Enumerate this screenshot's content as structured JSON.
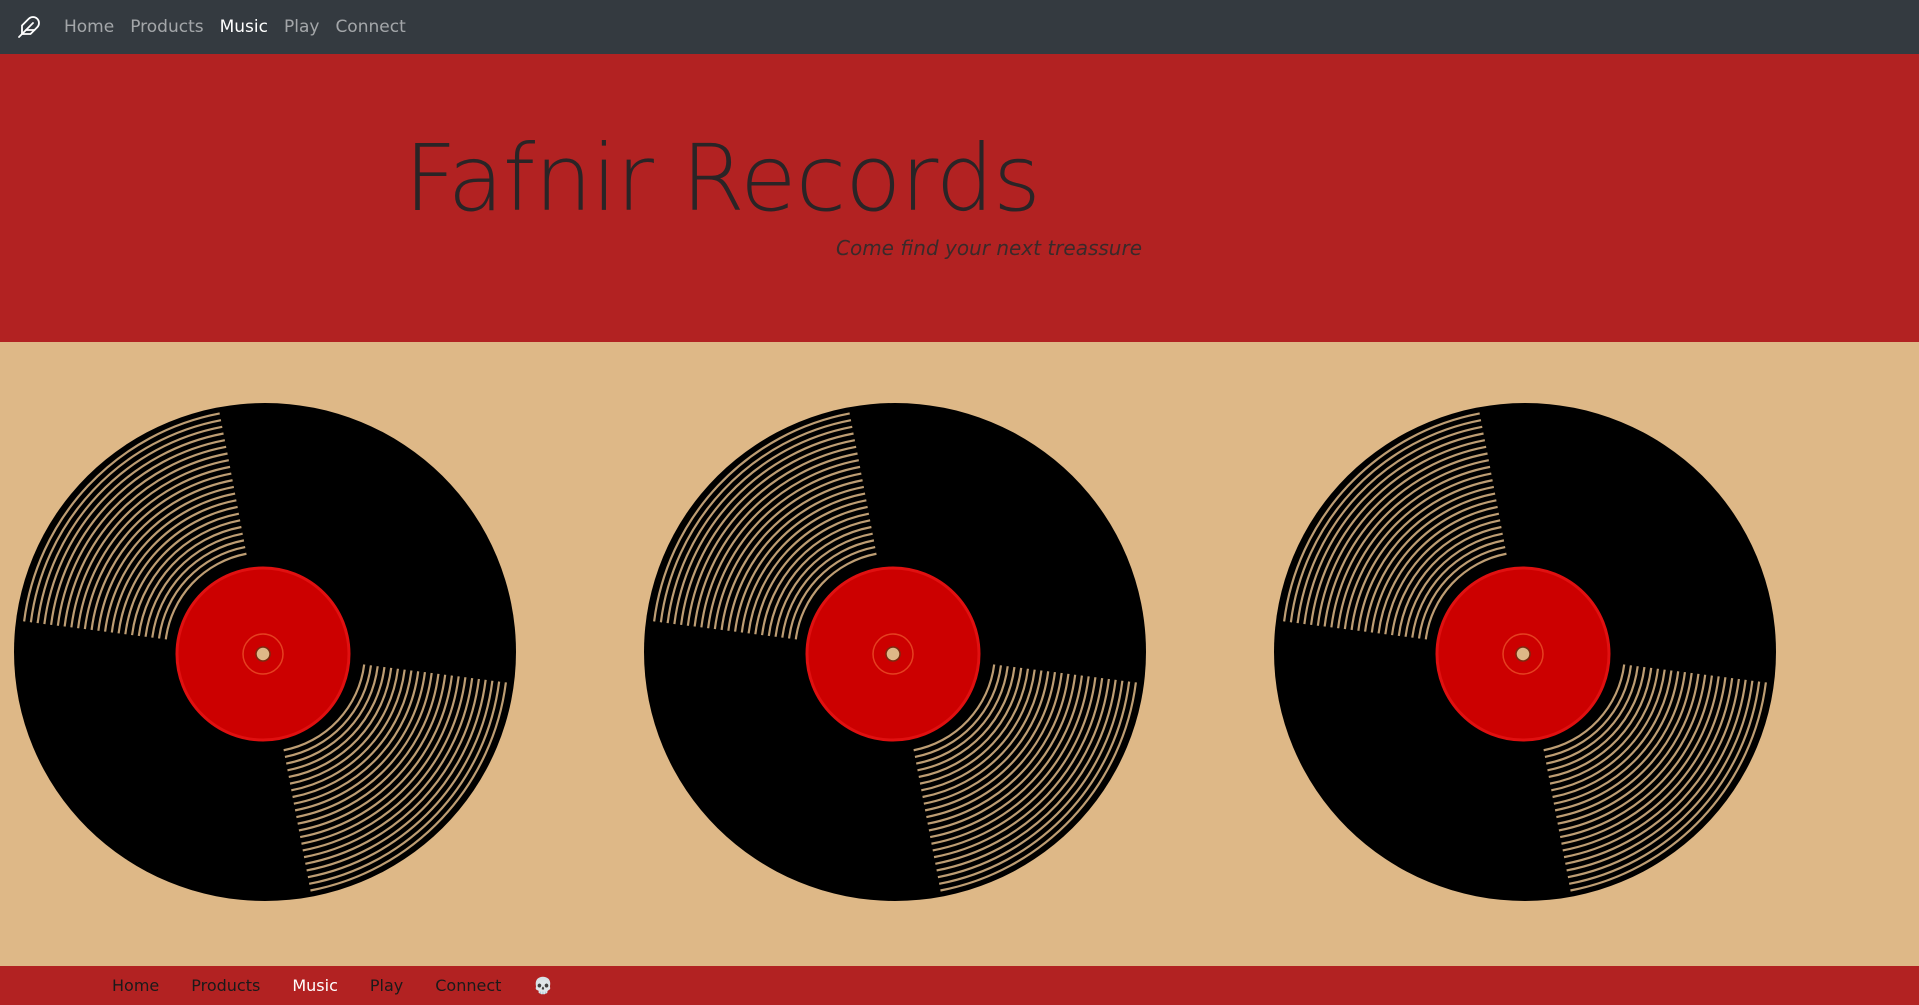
{
  "topnav": {
    "brand_icon": "feather-icon",
    "links": [
      {
        "label": "Home"
      },
      {
        "label": "Products"
      },
      {
        "label": "Music"
      },
      {
        "label": "Play"
      },
      {
        "label": "Connect"
      }
    ],
    "active": "Music"
  },
  "hero": {
    "title": "Fafnir Records",
    "subtitle": "Come find your next treassure"
  },
  "records": {
    "items": [
      {
        "icon": "vinyl-record-icon"
      },
      {
        "icon": "vinyl-record-icon"
      },
      {
        "icon": "vinyl-record-icon"
      }
    ],
    "label_color": "#cc0000"
  },
  "footnav": {
    "links": [
      {
        "label": "Home"
      },
      {
        "label": "Products"
      },
      {
        "label": "Music"
      },
      {
        "label": "Play"
      },
      {
        "label": "Connect"
      }
    ],
    "active": "Music",
    "extra_icon": "skull-icon",
    "extra_glyph": "💀"
  },
  "colors": {
    "navbar": "#343a40",
    "hero_bg": "#b22222",
    "records_bg": "#deb887",
    "footer_bg": "#b22222"
  }
}
